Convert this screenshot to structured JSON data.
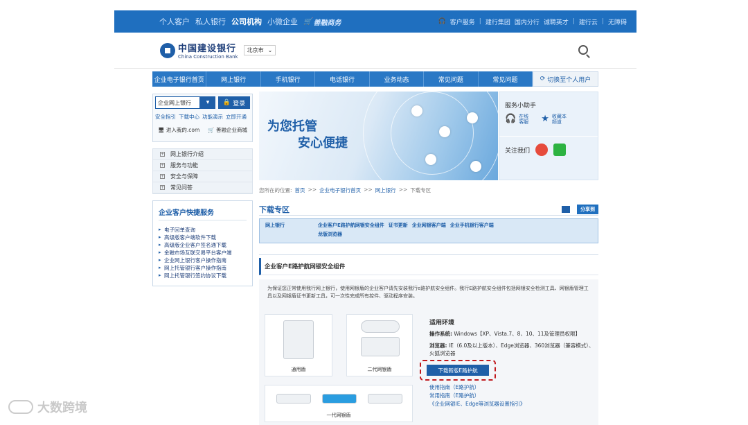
{
  "topbar": {
    "left": [
      "个人客户",
      "私人银行",
      "公司机构",
      "小微企业"
    ],
    "active": "公司机构",
    "shop": "善融商务",
    "right": [
      "客户服务",
      "建行集团",
      "国内分行",
      "诚聘英才",
      "建行云",
      "无障碍"
    ]
  },
  "header": {
    "logo_cn": "中国建设银行",
    "logo_en": "China Construction Bank",
    "city": "北京市"
  },
  "mainnav": [
    "企业电子银行首页",
    "网上银行",
    "手机银行",
    "电话银行",
    "业务动态",
    "常见问题",
    "常见问题",
    "切换至个人用户"
  ],
  "login": {
    "select": "企业网上银行",
    "button": "登录",
    "links": [
      "安全指引",
      "下载中心",
      "功能演示",
      "立即开通"
    ],
    "enter": "进入我的.com",
    "shop": "善融企业商城"
  },
  "menu": [
    "网上银行介绍",
    "服务与功能",
    "安全与保障",
    "常见问答"
  ],
  "service": {
    "title": "企业客户快捷服务",
    "items": [
      "电子回单查询",
      "高级版客户端软件下载",
      "高级版企业客户签名通下载",
      "金融市场互联交易平台客户端",
      "企业网上银行客户操作指南",
      "网上托管银行客户操作指南",
      "网上托管银行签约协议下载"
    ]
  },
  "banner": {
    "line1": "为您托管",
    "line2": "安心便捷"
  },
  "helper": {
    "title": "服务小助手",
    "online": "在线客服",
    "collect": "收藏本频道",
    "follow": "关注我们"
  },
  "breadcrumb": {
    "prefix": "您所在的位置:",
    "items": [
      "首页",
      "企业电子银行首页",
      "网上银行",
      "下载专区"
    ]
  },
  "download": {
    "title": "下载专区",
    "share": "分享到",
    "tabs_row1": [
      "网上银行",
      "企业客户E路护航网银安全组件",
      "证书更新",
      "企业网银客户端",
      "企业手机银行客户端"
    ],
    "tabs_row2": [
      "龙版浏览器"
    ],
    "section_title": "企业客户E路护航网银安全组件",
    "desc": "为保证您正常使用我行网上银行，使用网银盾的企业客户请先安装我行e路护航安全组件。我行E路护航安全组件包括网银安全检测工具、网银盾管理工具以及网银盾证书更新工具，可一次性完成所有控件、驱动程序安装。",
    "card1": "通用盾",
    "card2": "二代网银盾",
    "card3": "一代网银盾",
    "env_title": "适用环境",
    "os_label": "操作系统:",
    "os_value": "Windows【XP、Vista.7、8、10、11及管理员权限】",
    "browser_label": "浏览器:",
    "browser_value": "IE（6.0及以上版本）、Edge浏览器、360浏览器（兼容模式）、火狐浏览器",
    "button": "下载新版E路护航",
    "guide1": "使用指南（E路护航）",
    "guide2": "常用指南（E路护航）",
    "guide3": "《企业网银IE、Edge等浏览器设置指引》"
  },
  "watermark": "大数跨境"
}
